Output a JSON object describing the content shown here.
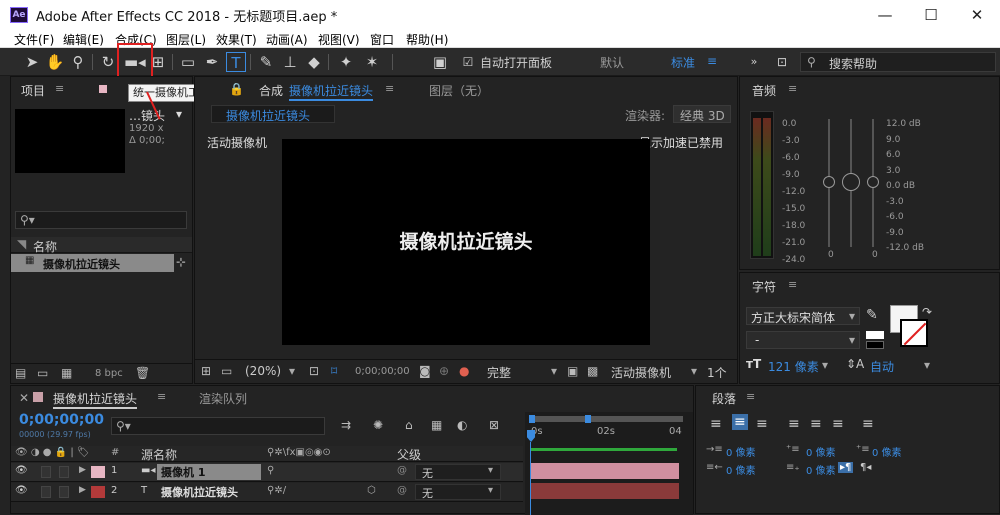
{
  "window": {
    "title": "Adobe After Effects CC 2018 - 无标题项目.aep *",
    "logo": "Ae"
  },
  "menu": [
    "文件(F)",
    "编辑(E)",
    "合成(C)",
    "图层(L)",
    "效果(T)",
    "动画(A)",
    "视图(V)",
    "窗口",
    "帮助(H)"
  ],
  "toolbar": {
    "auto_open": "自动打开面板",
    "workspace_default": "默认",
    "workspace_standard": "标准",
    "search_placeholder": "搜索帮助"
  },
  "tooltip": "统一摄像机工具 (C)",
  "project": {
    "tab": "项目",
    "item_name_partial": "…镜头",
    "info_line1": "1920 x",
    "info_line2": "Δ 0;00;",
    "col_name": "名称",
    "items": [
      {
        "name": "摄像机拉近镜头",
        "icon": "composition-icon"
      }
    ],
    "bpc": "8 bpc"
  },
  "composition": {
    "tab_prefix": "合成",
    "tab_name": "摄像机拉近镜头",
    "layer_tab": "图层（无）",
    "breadcrumb": "摄像机拉近镜头",
    "renderer_label": "渲染器:",
    "renderer_value": "经典 3D",
    "active_camera": "活动摄像机",
    "gpu_notice": "显示加速已禁用",
    "canvas_text": "摄像机拉近镜头",
    "zoom": "(20%)",
    "timecode": "0;00;00;00",
    "resolution": "完整",
    "view_mode": "活动摄像机",
    "views": "1个"
  },
  "audio": {
    "tab": "音频",
    "left_scale": [
      "0.0",
      "-3.0",
      "-6.0",
      "-9.0",
      "-12.0",
      "-15.0",
      "-18.0",
      "-21.0",
      "-24.0"
    ],
    "right_scale": [
      "12.0 dB",
      "9.0",
      "6.0",
      "3.0",
      "0.0 dB",
      "-3.0",
      "-6.0",
      "-9.0",
      "-12.0 dB"
    ],
    "zero_left": "0",
    "zero_right": "0"
  },
  "character": {
    "tab": "字符",
    "font": "方正大标宋简体",
    "style": "-",
    "size": "121 像素",
    "leading": "自动"
  },
  "paragraph": {
    "tab": "段落",
    "indent_left": "0 像素",
    "indent_right": "0 像素",
    "indent_first": "0 像素",
    "space_before": "0 像素",
    "space_after": "0 像素"
  },
  "timeline": {
    "tab": "摄像机拉近镜头",
    "render_queue": "渲染队列",
    "timecode": "0;00;00;00",
    "fps": "00000 (29.97 fps)",
    "ruler": [
      "0s",
      "02s",
      "04"
    ],
    "columns": {
      "num": "#",
      "source": "源名称",
      "parent": "父级"
    },
    "layers": [
      {
        "num": "1",
        "name": "摄像机 1",
        "type_icon": "camera-icon",
        "color": "#e7b6c3",
        "parent": "无",
        "bar_color": "#d08fa0"
      },
      {
        "num": "2",
        "name": "摄像机拉近镜头",
        "type_icon": "text-layer-icon",
        "color": "#b33a3a",
        "parent": "无",
        "bar_color": "#8a3a3a"
      }
    ]
  },
  "colors": {
    "accent": "#3b8be0",
    "highlight_box": "#e02020"
  }
}
